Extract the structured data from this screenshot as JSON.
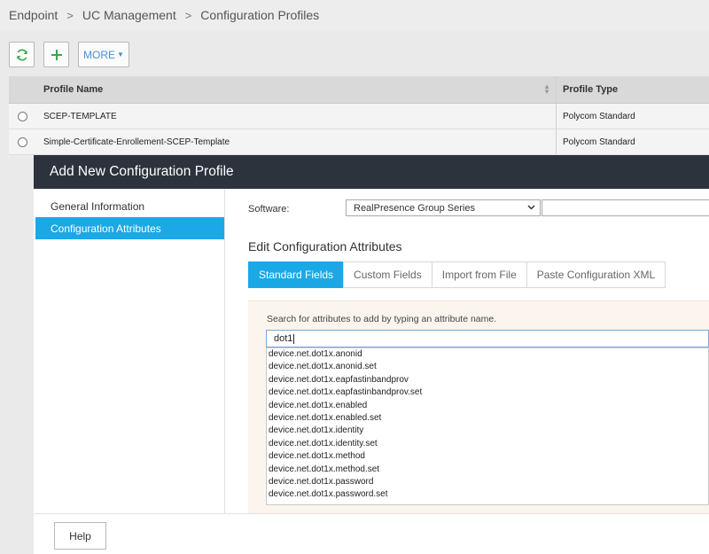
{
  "breadcrumb": {
    "items": [
      "Endpoint",
      "UC Management",
      "Configuration Profiles"
    ],
    "separator": ">"
  },
  "toolbar": {
    "more_label": "MORE"
  },
  "grid": {
    "columns": [
      "Profile Name",
      "Profile Type"
    ],
    "rows": [
      {
        "name": "SCEP-TEMPLATE",
        "type": "Polycom Standard"
      },
      {
        "name": "Simple-Certificate-Enrollement-SCEP-Template",
        "type": "Polycom Standard"
      }
    ]
  },
  "modal": {
    "title": "Add New Configuration Profile",
    "sidebar": {
      "items": [
        {
          "label": "General Information",
          "active": false
        },
        {
          "label": "Configuration Attributes",
          "active": true
        }
      ]
    },
    "software": {
      "label": "Software:",
      "selected": "RealPresence Group Series"
    },
    "section_title": "Edit Configuration Attributes",
    "tabs": [
      {
        "label": "Standard Fields",
        "active": true
      },
      {
        "label": "Custom Fields",
        "active": false
      },
      {
        "label": "Import from File",
        "active": false
      },
      {
        "label": "Paste Configuration XML",
        "active": false
      }
    ],
    "search": {
      "hint": "Search for attributes to add by typing an attribute name.",
      "value": "dot1",
      "suggestions": [
        "device.net.dot1x.anonid",
        "device.net.dot1x.anonid.set",
        "device.net.dot1x.eapfastinbandprov",
        "device.net.dot1x.eapfastinbandprov.set",
        "device.net.dot1x.enabled",
        "device.net.dot1x.enabled.set",
        "device.net.dot1x.identity",
        "device.net.dot1x.identity.set",
        "device.net.dot1x.method",
        "device.net.dot1x.method.set",
        "device.net.dot1x.password",
        "device.net.dot1x.password.set"
      ]
    },
    "footer": {
      "help_label": "Help"
    }
  },
  "colors": {
    "accent": "#1ba8e6",
    "header_dark": "#2c333d",
    "green_icon": "#3aa64a"
  },
  "icons": {
    "refresh": "refresh-icon",
    "add": "plus-icon",
    "caret": "caret-down-icon",
    "sort": "sort-icon",
    "select_chevron": "chevron-down-icon"
  }
}
